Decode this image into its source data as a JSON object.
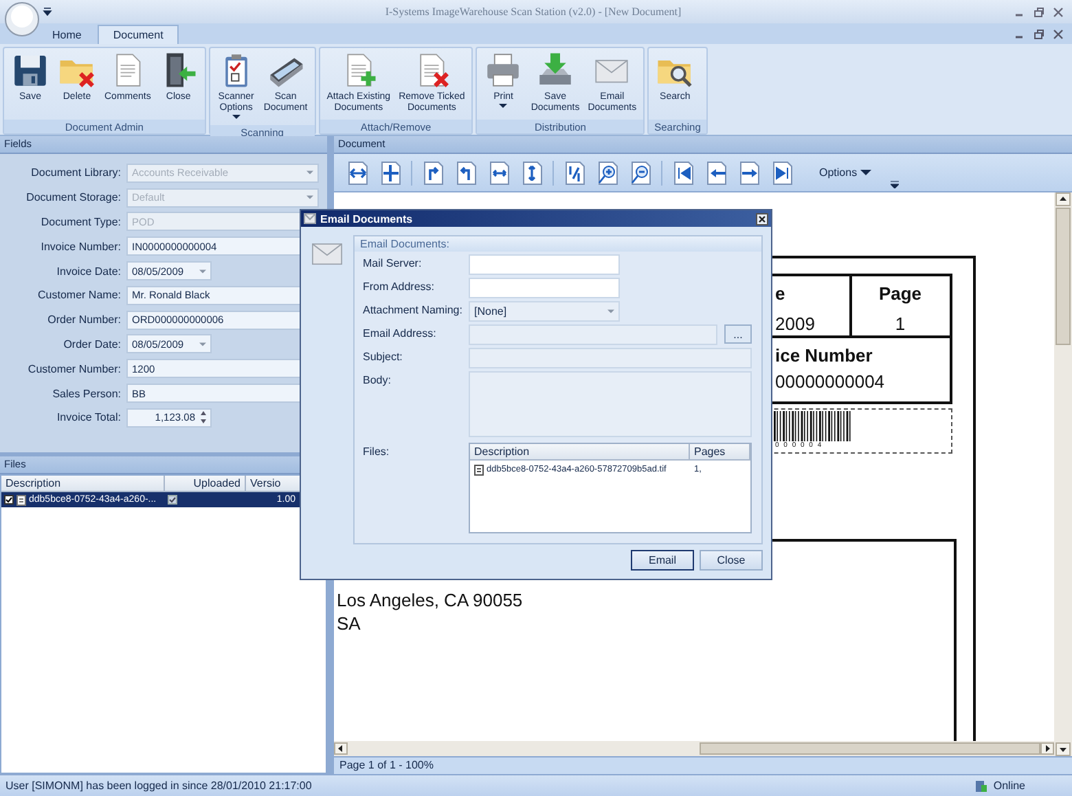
{
  "window": {
    "title": "I-Systems ImageWarehouse Scan Station (v2.0) - [New Document]"
  },
  "tabs": [
    {
      "label": "Home",
      "selected": false
    },
    {
      "label": "Document",
      "selected": true
    }
  ],
  "ribbon": [
    {
      "label": "Document Admin",
      "buttons": [
        {
          "label": "Save",
          "kind": "save"
        },
        {
          "label": "Delete",
          "kind": "delete"
        },
        {
          "label": "Comments",
          "kind": "comments"
        },
        {
          "label": "Close",
          "kind": "close"
        }
      ]
    },
    {
      "label": "Scanning",
      "buttons": [
        {
          "label": "Scanner\nOptions",
          "kind": "options",
          "dropdown": true
        },
        {
          "label": "Scan\nDocument",
          "kind": "scan"
        }
      ]
    },
    {
      "label": "Attach/Remove",
      "buttons": [
        {
          "label": "Attach Existing\nDocuments",
          "kind": "attach"
        },
        {
          "label": "Remove Ticked\nDocuments",
          "kind": "remove"
        }
      ]
    },
    {
      "label": "Distribution",
      "buttons": [
        {
          "label": "Print",
          "kind": "print",
          "dropdown": true
        },
        {
          "label": "Save\nDocuments",
          "kind": "export"
        },
        {
          "label": "Email\nDocuments",
          "kind": "email"
        }
      ]
    },
    {
      "label": "Searching",
      "buttons": [
        {
          "label": "Search",
          "kind": "search"
        }
      ]
    }
  ],
  "fields_panel": {
    "title": "Fields",
    "fields": [
      {
        "label": "Document Library:",
        "value": "Accounts Receivable",
        "kind": "combo",
        "disabled": true
      },
      {
        "label": "Document Storage:",
        "value": "Default",
        "kind": "combo",
        "disabled": true
      },
      {
        "label": "Document Type:",
        "value": "POD",
        "kind": "text",
        "disabled": true
      },
      {
        "label": "Invoice Number:",
        "value": "IN0000000000004",
        "kind": "text",
        "disabled": false
      },
      {
        "label": "Invoice Date:",
        "value": "08/05/2009",
        "kind": "date",
        "disabled": false
      },
      {
        "label": "Customer Name:",
        "value": "Mr. Ronald Black",
        "kind": "text",
        "disabled": false
      },
      {
        "label": "Order Number:",
        "value": "ORD000000000006",
        "kind": "text",
        "disabled": false
      },
      {
        "label": "Order Date:",
        "value": "08/05/2009",
        "kind": "date",
        "disabled": false
      },
      {
        "label": "Customer Number:",
        "value": "1200",
        "kind": "text",
        "disabled": false
      },
      {
        "label": "Sales Person:",
        "value": "BB",
        "kind": "combo",
        "disabled": false
      },
      {
        "label": "Invoice Total:",
        "value": "1,123.08",
        "kind": "spin",
        "disabled": false
      }
    ]
  },
  "files_panel": {
    "title": "Files",
    "columns": [
      "Description",
      "Uploaded",
      "Versio"
    ],
    "rows": [
      {
        "checked": true,
        "description": "ddb5bce8-0752-43a4-a260-...",
        "uploaded": true,
        "version": "1.00",
        "selected": true
      }
    ]
  },
  "document_panel": {
    "title": "Document",
    "options": "Options",
    "page": {
      "date_label": "e",
      "date_value": "2009",
      "page_label": "Page",
      "page_value": "1",
      "invoice_label": "ice Number",
      "invoice_value": "00000000004",
      "barcode_digits": "0 0 0 0 0 4",
      "address_lines": [
        "Los Angeles, CA 90055",
        "SA"
      ]
    },
    "status": "Page 1 of 1 - 100%"
  },
  "dialog": {
    "title": "Email Documents",
    "group": "Email Documents:",
    "fields": [
      {
        "label": "Mail Server:",
        "kind": "short"
      },
      {
        "label": "From Address:",
        "kind": "short"
      },
      {
        "label": "Attachment Naming:",
        "kind": "combo",
        "value": "[None]"
      },
      {
        "label": "Email Address:",
        "kind": "browse",
        "button": "..."
      },
      {
        "label": "Subject:",
        "kind": "wide"
      },
      {
        "label": "Body:",
        "kind": "memo"
      }
    ],
    "files": {
      "label": "Files:",
      "columns": [
        "Description",
        "Pages"
      ],
      "rows": [
        {
          "description": "ddb5bce8-0752-43a4-a260-57872709b5ad.tif",
          "pages": "1,"
        }
      ]
    },
    "buttons": [
      {
        "label": "Email",
        "default": true
      },
      {
        "label": "Close",
        "default": false
      }
    ]
  },
  "status_bar": {
    "message": "User [SIMONM] has been logged in since 28/01/2010 21:17:00",
    "connection": "Online"
  }
}
